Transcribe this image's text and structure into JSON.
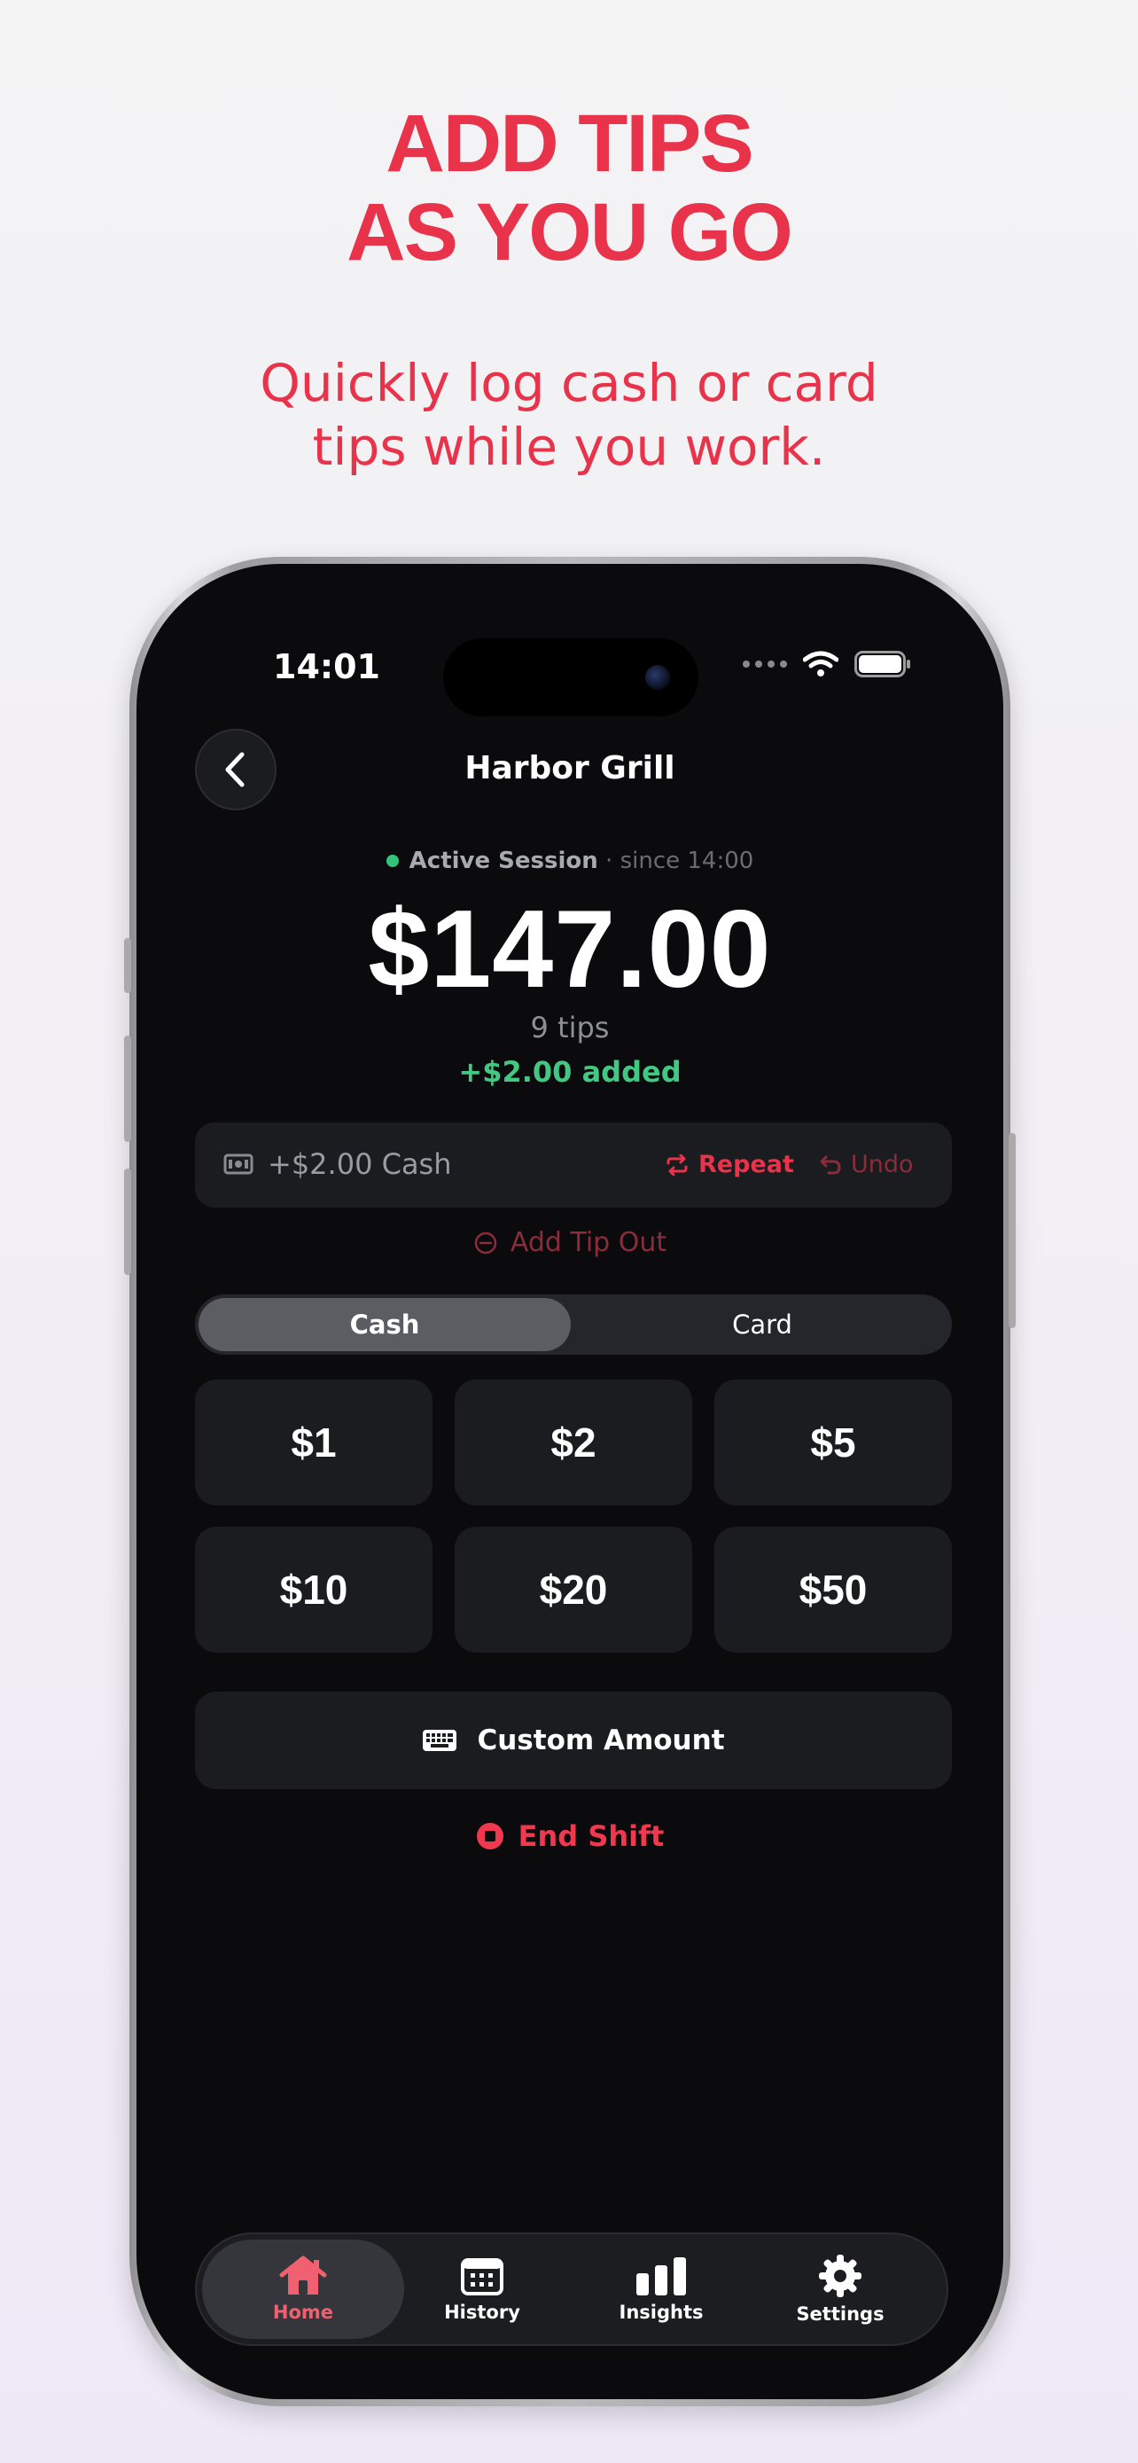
{
  "promo": {
    "headline_line1": "ADD TIPS",
    "headline_line2": "AS YOU GO",
    "subline_line1": "Quickly log cash or card",
    "subline_line2": "tips while you work."
  },
  "status_bar": {
    "time": "14:01"
  },
  "header": {
    "venue": "Harbor Grill"
  },
  "session": {
    "status_label": "Active Session",
    "since": "· since 14:00",
    "total": "$147.00",
    "tips_count": "9 tips",
    "added": "+$2.00 added"
  },
  "last_tip": {
    "text": "+$2.00 Cash",
    "repeat_label": "Repeat",
    "undo_label": "Undo"
  },
  "tip_out_label": "Add Tip Out",
  "tip_type": {
    "options": [
      "Cash",
      "Card"
    ],
    "selected": "Cash"
  },
  "quick_amounts": [
    "$1",
    "$2",
    "$5",
    "$10",
    "$20",
    "$50"
  ],
  "custom_label": "Custom Amount",
  "end_shift_label": "End Shift",
  "tabs": [
    {
      "label": "Home",
      "icon": "house-icon",
      "active": true
    },
    {
      "label": "History",
      "icon": "calendar-icon",
      "active": false
    },
    {
      "label": "Insights",
      "icon": "bar-chart-icon",
      "active": false
    },
    {
      "label": "Settings",
      "icon": "gear-icon",
      "active": false
    }
  ],
  "colors": {
    "accent": "#e8334a",
    "success": "#43c884",
    "surface": "#1b1c20",
    "background": "#0b0b0e"
  }
}
